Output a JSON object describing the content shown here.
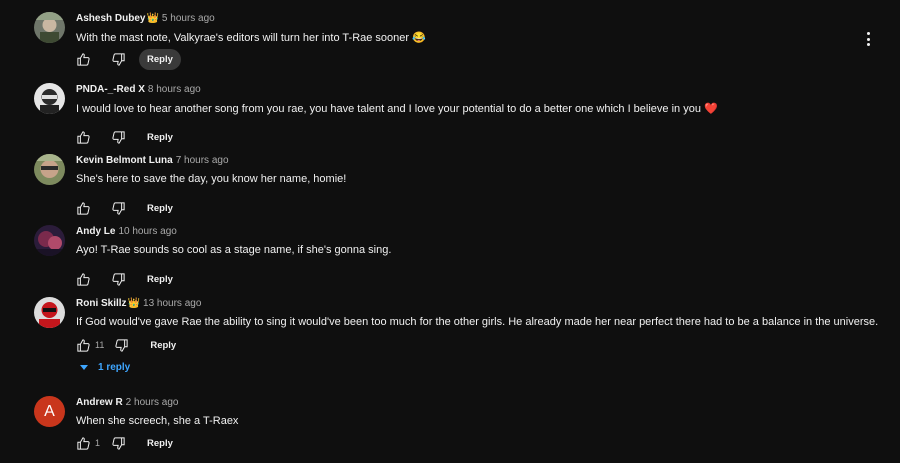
{
  "comments": [
    {
      "author": "Ashesh Dubey",
      "badge": "👑",
      "time": "5 hours ago",
      "text": "With the mast note, Valkyrae's editors will turn her into T-Rae sooner 😂",
      "likes": "",
      "reply_label": "Reply",
      "avatar_colors": [
        "#7a7f70",
        "#4b5a3d"
      ]
    },
    {
      "author": "PNDA-_-Red X",
      "badge": "",
      "time": "8 hours ago",
      "text": "I would love to hear another song from you rae, you have talent and I love your potential to do a better one which I believe in you ❤️",
      "likes": "",
      "reply_label": "Reply",
      "avatar_colors": [
        "#d8d8d8",
        "#2a2a2a"
      ]
    },
    {
      "author": "Kevin Belmont Luna",
      "badge": "",
      "time": "7 hours ago",
      "text": "She's here to save the day, you know her name, homie!",
      "likes": "",
      "reply_label": "Reply",
      "avatar_colors": [
        "#8c9a6c",
        "#3b4a2a"
      ]
    },
    {
      "author": "Andy Le",
      "badge": "",
      "time": "10 hours ago",
      "text": "Ayo! T-Rae sounds so cool as a stage name, if she's gonna sing.",
      "likes": "",
      "reply_label": "Reply",
      "avatar_colors": [
        "#6b2a4a",
        "#2b1c3a"
      ]
    },
    {
      "author": "Roni Skillz",
      "badge": "👑",
      "time": "13 hours ago",
      "text": "If God would've gave Rae the ability to sing it would've been too much for the other girls. He already made her near perfect there had to be a balance in the universe.",
      "likes": "11",
      "reply_label": "Reply",
      "avatar_colors": [
        "#d9d9d9",
        "#c4161c"
      ]
    },
    {
      "author": "Andrew R",
      "badge": "",
      "time": "2 hours ago",
      "text": "When she screech, she a T-Raex",
      "likes": "1",
      "reply_label": "Reply",
      "avatar_letter": "A"
    }
  ],
  "replies_toggle": "1 reply",
  "icons": {
    "like": "thumbs-up-icon",
    "dislike": "thumbs-down-icon",
    "more": "more-vert-icon"
  },
  "colors": {
    "background": "#0f0f0f",
    "link": "#3ea6ff",
    "avatar_letter_bg": "#c9361c"
  }
}
